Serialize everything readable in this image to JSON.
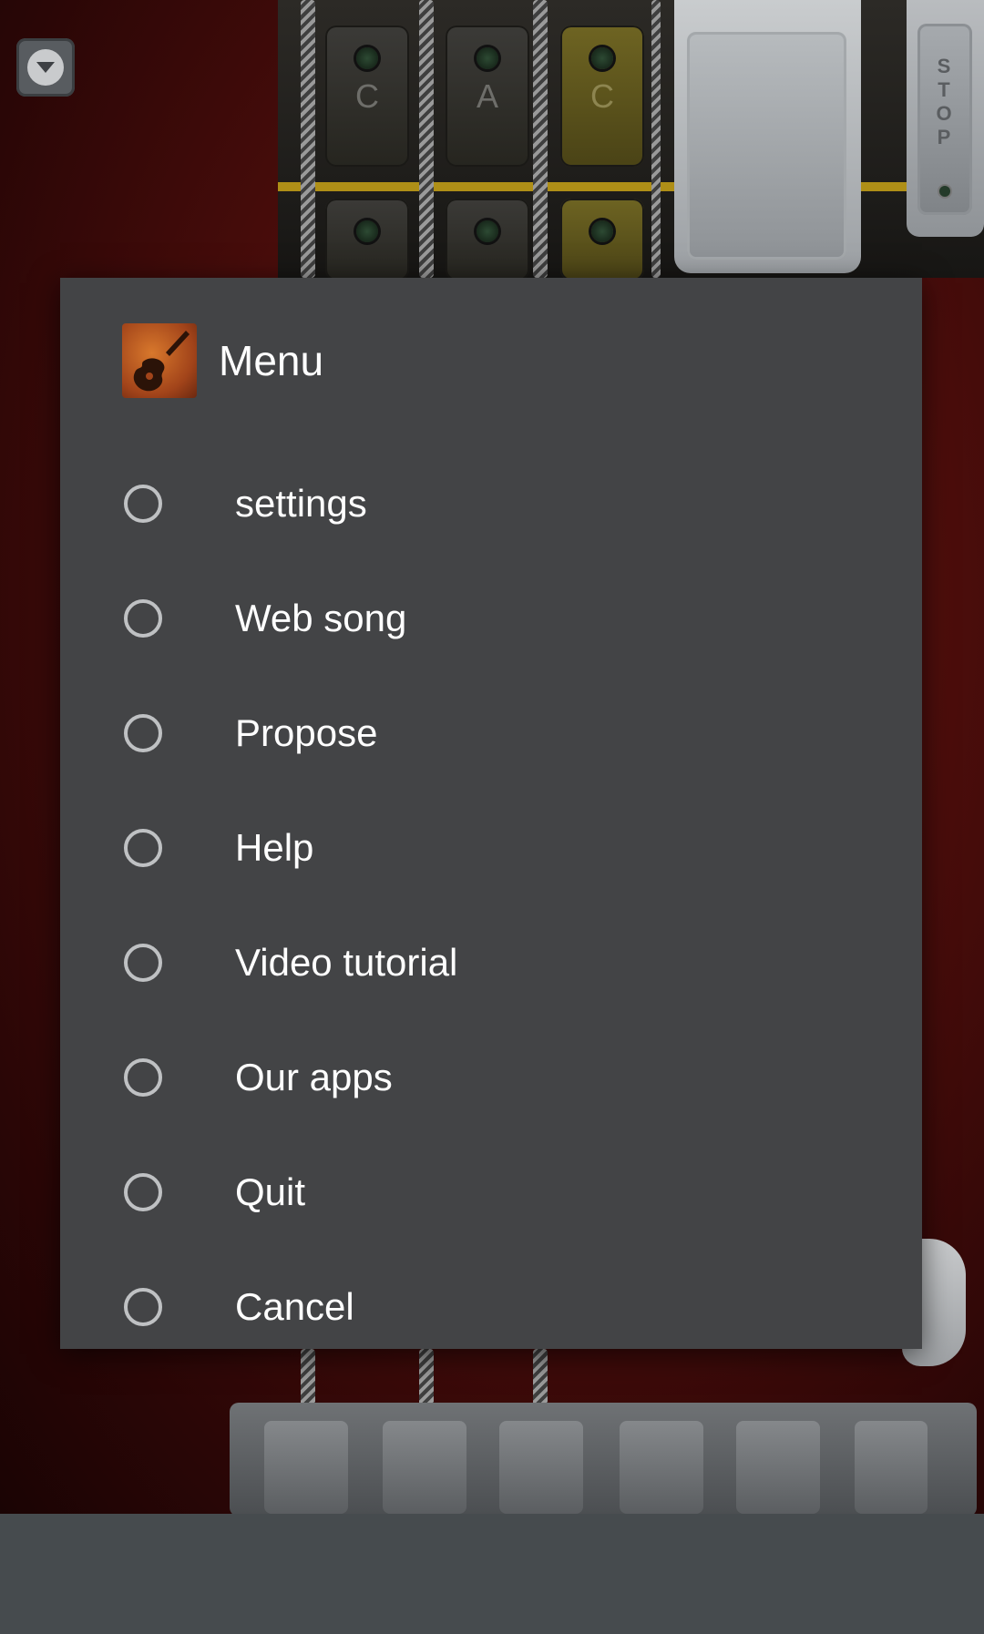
{
  "background": {
    "chord_keys": [
      {
        "label": "C"
      },
      {
        "label": "A"
      },
      {
        "label": "C"
      }
    ],
    "stop_letters": [
      "S",
      "T",
      "O",
      "P"
    ]
  },
  "top_icon": {
    "icon": "chevron-down-icon"
  },
  "menu": {
    "title": "Menu",
    "app_icon": "guitar-icon",
    "items": [
      {
        "label": "settings"
      },
      {
        "label": "Web song"
      },
      {
        "label": "Propose"
      },
      {
        "label": "Help"
      },
      {
        "label": "Video tutorial"
      },
      {
        "label": "Our apps"
      },
      {
        "label": "Quit"
      },
      {
        "label": "Cancel"
      }
    ]
  },
  "colors": {
    "modal_bg": "#434446",
    "text": "#ffffff",
    "radio": "#bfc1c3",
    "bottom_bar": "#464b4e"
  }
}
